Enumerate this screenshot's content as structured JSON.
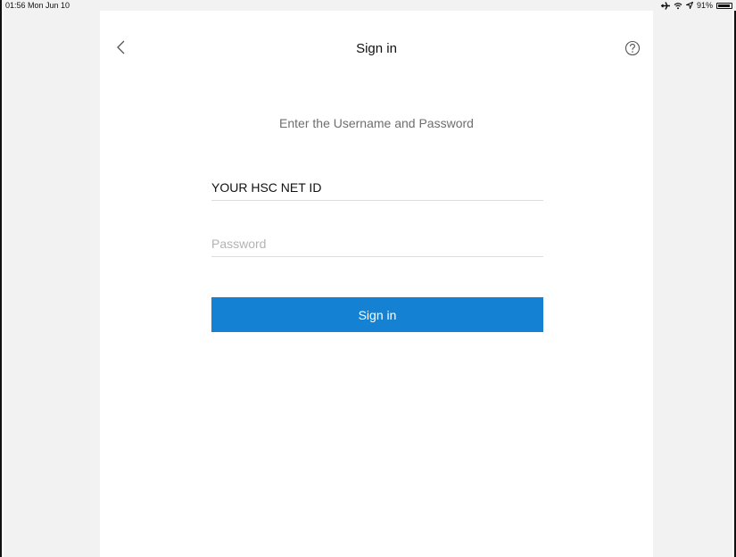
{
  "status_bar": {
    "time": "01:56 Mon Jun 10",
    "battery": "91%",
    "battery_level": 0.91,
    "icons": [
      "airplane-icon",
      "wifi-icon",
      "location-icon",
      "battery-icon"
    ]
  },
  "nav": {
    "back_icon": "chevron-left-icon",
    "title": "Sign in",
    "help_icon": "help-icon"
  },
  "form": {
    "instruction": "Enter the Username and Password",
    "username_value": "YOUR HSC NET ID",
    "password_placeholder": "Password",
    "signin_label": "Sign in"
  },
  "colors": {
    "accent": "#1581d2",
    "side_background": "#f2f2f2"
  }
}
